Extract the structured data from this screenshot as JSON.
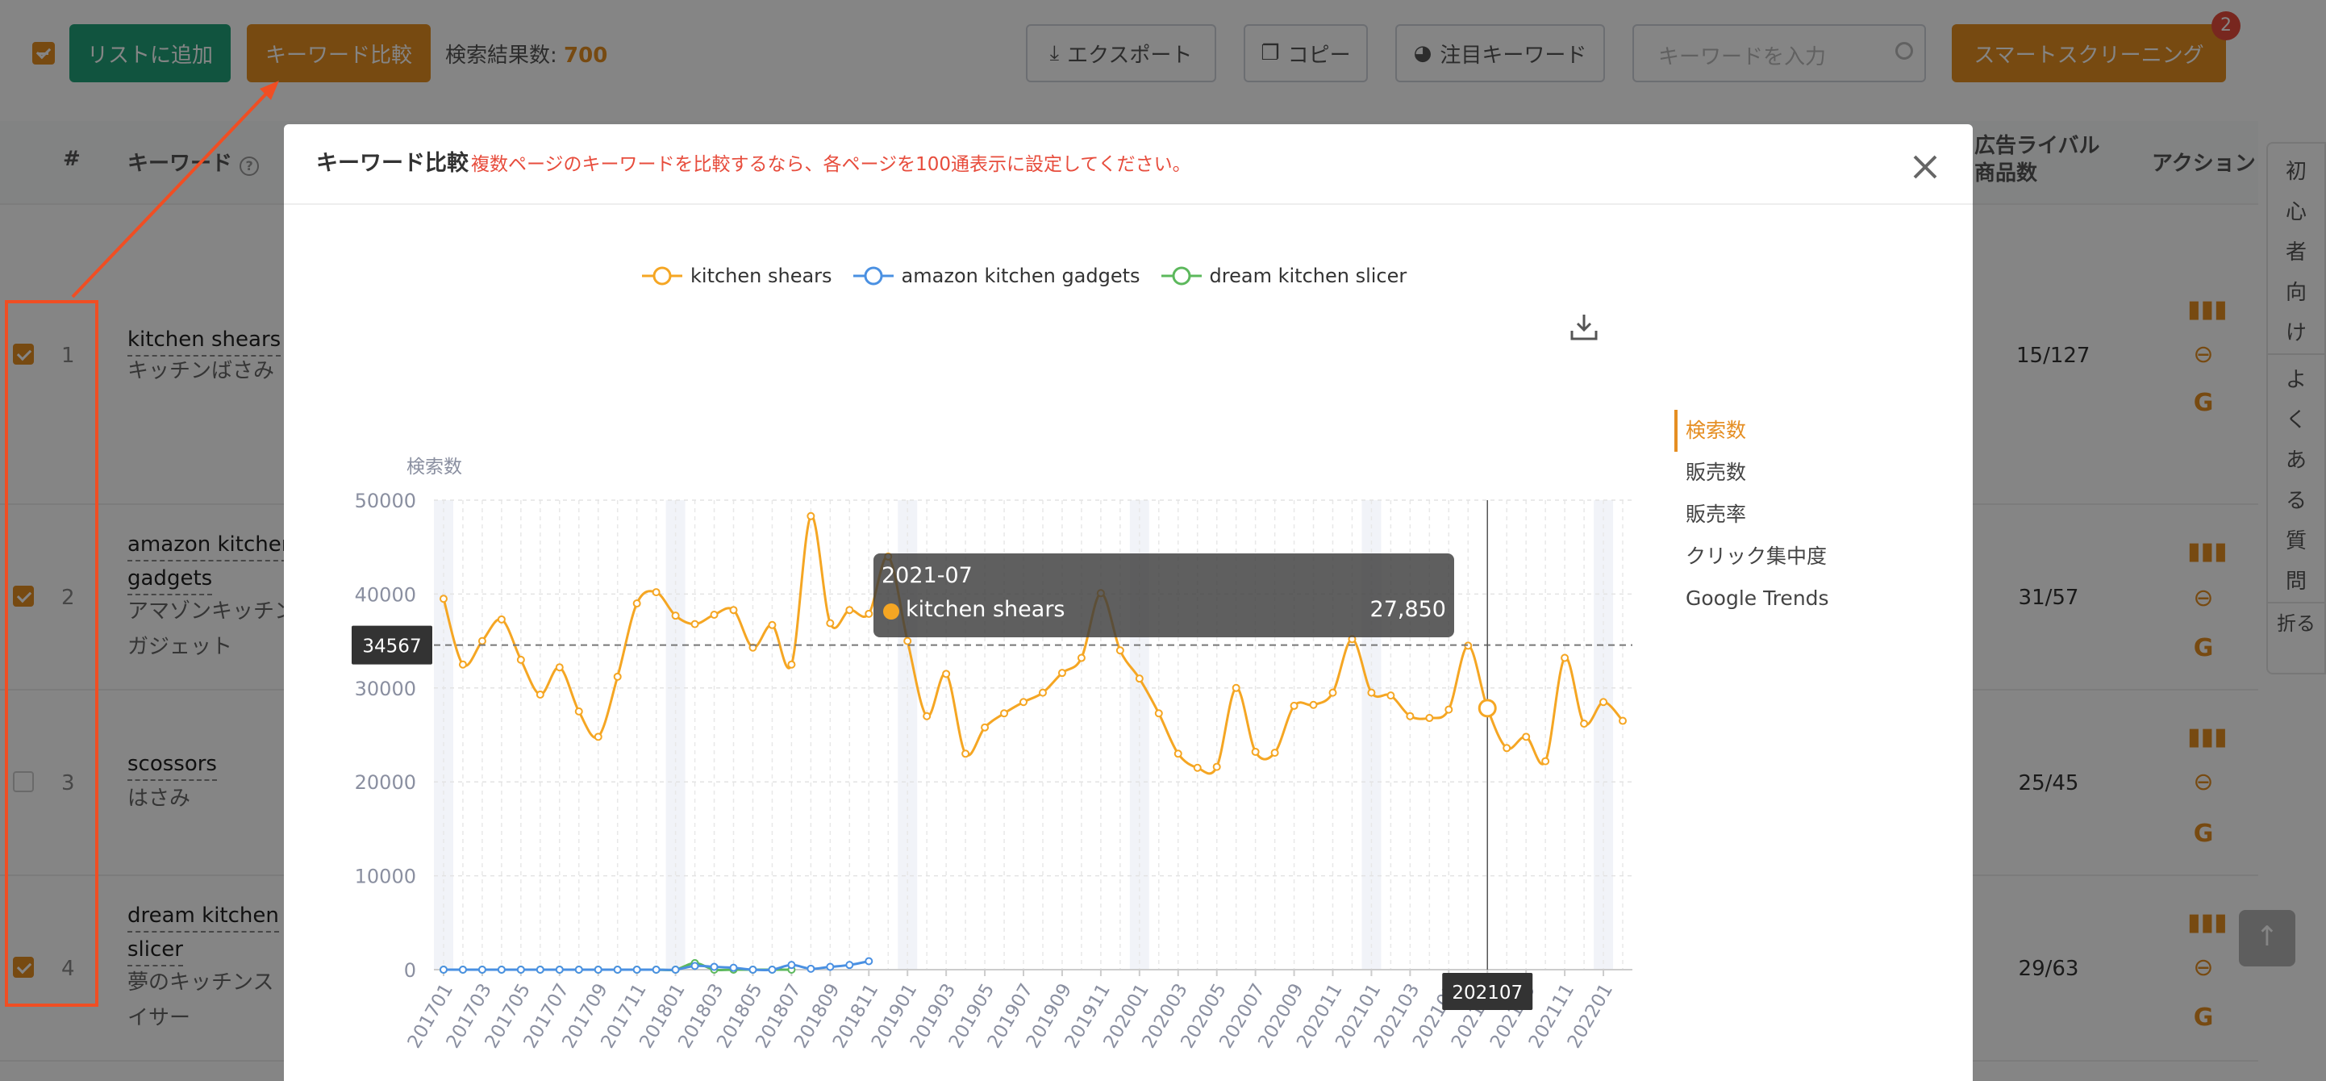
{
  "toolbar": {
    "add_to_list": "リストに追加",
    "compare": "キーワード比較",
    "result_label": "検索結果数:",
    "result_count": "700",
    "export": "エクスポート",
    "copy": "コピー",
    "focus_keywords": "注目キーワード",
    "search_placeholder": "キーワードを入力",
    "smart_screening": "スマートスクリーニング",
    "smart_badge": "2"
  },
  "table": {
    "col_index": "#",
    "col_keyword": "キーワード",
    "col_ad_rival_line1": "広告ライバル",
    "col_ad_rival_line2": "商品数",
    "col_action": "アクション",
    "rows": [
      {
        "index": "1",
        "keyword": "kitchen shears",
        "sub": "キッチンばさみ",
        "ratio": "15/127",
        "checked": true
      },
      {
        "index": "2",
        "keyword_l1": "amazon kitchen",
        "keyword_l2": "gadgets",
        "sub_l1": "アマゾンキッチン",
        "sub_l2": "ガジェット",
        "ratio": "31/57",
        "checked": true
      },
      {
        "index": "3",
        "keyword": "scossors",
        "sub": "はさみ",
        "ratio": "25/45",
        "checked": false
      },
      {
        "index": "4",
        "keyword_l1": "dream kitchen",
        "keyword_l2": "slicer",
        "sub_l1": "夢のキッチンス",
        "sub_l2": "イサー",
        "ratio": "29/63",
        "checked": true
      }
    ]
  },
  "side_panel": {
    "beginner": [
      "初",
      "心",
      "者",
      "向",
      "け"
    ],
    "faq": [
      "よ",
      "く",
      "あ",
      "る",
      "質",
      "問"
    ],
    "fold": "折る"
  },
  "modal": {
    "title": "キーワード比較",
    "notice": "複数ページのキーワードを比較するなら、各ページを100通表示に設定してください。",
    "legend": [
      {
        "name": "kitchen shears",
        "color": "#f5a623"
      },
      {
        "name": "amazon kitchen gadgets",
        "color": "#4a90e2"
      },
      {
        "name": "dream kitchen slicer",
        "color": "#5cb85c"
      }
    ],
    "metrics": [
      "検索数",
      "販売数",
      "販売率",
      "クリック集中度",
      "Google Trends"
    ],
    "active_metric": "検索数",
    "tooltip": {
      "title": "2021-07",
      "series": "kitchen shears",
      "value": "27,850"
    },
    "crosshair_y_label": "34567",
    "crosshair_x_label": "202107"
  },
  "chart_data": {
    "type": "line",
    "ylabel": "検索数",
    "ylim": [
      0,
      50000
    ],
    "yticks": [
      0,
      10000,
      20000,
      30000,
      40000,
      50000
    ],
    "xtick_labels": [
      "201701",
      "201703",
      "201705",
      "201707",
      "201709",
      "201711",
      "201801",
      "201803",
      "201805",
      "201807",
      "201809",
      "201811",
      "201901",
      "201903",
      "201905",
      "201907",
      "201909",
      "201911",
      "202001",
      "202003",
      "202005",
      "202007",
      "202009",
      "202011",
      "202101",
      "202103",
      "202105",
      "202107",
      "202109",
      "202111",
      "202201"
    ],
    "x": [
      "201701",
      "201702",
      "201703",
      "201704",
      "201705",
      "201706",
      "201707",
      "201708",
      "201709",
      "201710",
      "201711",
      "201712",
      "201801",
      "201802",
      "201803",
      "201804",
      "201805",
      "201806",
      "201807",
      "201808",
      "201809",
      "201810",
      "201811",
      "201812",
      "201901",
      "201902",
      "201903",
      "201904",
      "201905",
      "201906",
      "201907",
      "201908",
      "201909",
      "201910",
      "201911",
      "201912",
      "202001",
      "202002",
      "202003",
      "202004",
      "202005",
      "202006",
      "202007",
      "202008",
      "202009",
      "202010",
      "202011",
      "202012",
      "202101",
      "202102",
      "202103",
      "202104",
      "202105",
      "202106",
      "202107",
      "202108",
      "202109",
      "202110",
      "202111",
      "202112",
      "202201",
      "202202"
    ],
    "series": [
      {
        "name": "kitchen shears",
        "color": "#f5a623",
        "values": [
          39500,
          32500,
          35000,
          37300,
          33000,
          29300,
          32200,
          27500,
          24800,
          31200,
          39000,
          40200,
          37700,
          36800,
          37800,
          38300,
          34300,
          36700,
          32500,
          48300,
          36900,
          38300,
          37900,
          44000,
          35000,
          27000,
          31500,
          23000,
          25800,
          27300,
          28500,
          29500,
          31600,
          33200,
          40100,
          34000,
          31000,
          27300,
          23000,
          21500,
          21600,
          30000,
          23200,
          23100,
          28100,
          28200,
          29500,
          35200,
          29500,
          29200,
          27000,
          26800,
          27700,
          34500,
          27850,
          23600,
          24800,
          22200,
          33200,
          26200,
          28500,
          26500
        ]
      },
      {
        "name": "amazon kitchen gadgets",
        "color": "#4a90e2",
        "values": [
          0,
          0,
          0,
          0,
          0,
          0,
          0,
          0,
          0,
          0,
          0,
          0,
          0,
          400,
          300,
          200,
          0,
          0,
          500,
          100,
          300,
          500,
          900
        ]
      },
      {
        "name": "dream kitchen slicer",
        "color": "#5cb85c",
        "values": [
          0,
          0,
          0,
          0,
          0,
          0,
          0,
          0,
          0,
          0,
          0,
          0,
          0,
          700,
          0,
          0,
          0,
          0,
          0
        ]
      }
    ]
  }
}
